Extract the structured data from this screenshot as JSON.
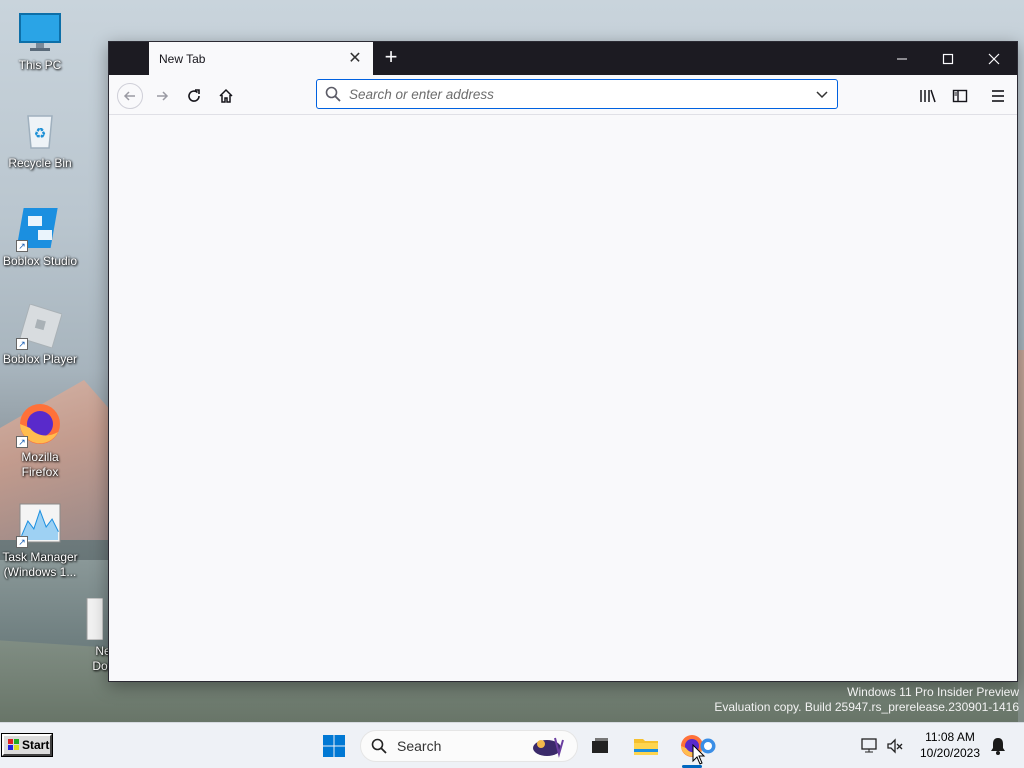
{
  "desktop": {
    "icons": [
      {
        "label": "This PC",
        "icon": "monitor-icon"
      },
      {
        "label": "Recycle Bin",
        "icon": "recycle-bin-icon"
      },
      {
        "label": "Boblox Studio",
        "icon": "studio-icon"
      },
      {
        "label": "Boblox Player",
        "icon": "player-icon"
      },
      {
        "label": "Mozilla Firefox",
        "icon": "firefox-icon"
      },
      {
        "label": "Task Manager (Windows 1...",
        "icon": "task-manager-icon"
      },
      {
        "label": "Ne Doc",
        "icon": "document-icon"
      }
    ]
  },
  "browser": {
    "tab_title": "New Tab",
    "address_placeholder": "Search or enter address",
    "address_value": ""
  },
  "watermark": {
    "line1": "Windows 11 Pro Insider Preview",
    "line2": "Evaluation copy. Build 25947.rs_prerelease.230901-1416"
  },
  "taskbar": {
    "start_label": "Start",
    "search_label": "Search",
    "time": "11:08 AM",
    "date": "10/20/2023"
  },
  "colors": {
    "accent": "#0061e0",
    "tabbar": "#1c1b22",
    "firefox_orange": "#ff7139"
  }
}
